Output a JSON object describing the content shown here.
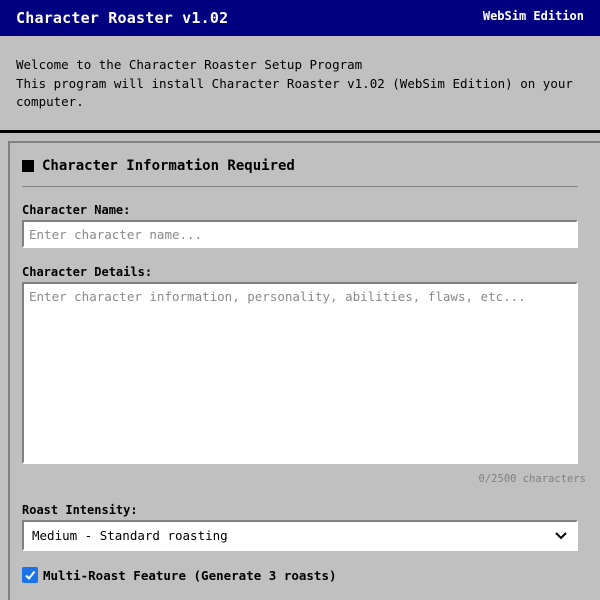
{
  "titlebar": {
    "title": "Character Roaster v1.02",
    "edition": "WebSim Edition"
  },
  "welcome": {
    "line1": "Welcome to the Character Roaster Setup Program",
    "line2": "This program will install Character Roaster v1.02 (WebSim Edition) on your computer."
  },
  "section": {
    "title": "Character Information Required"
  },
  "form": {
    "name_label": "Character Name:",
    "name_placeholder": "Enter character name...",
    "name_value": "",
    "details_label": "Character Details:",
    "details_placeholder": "Enter character information, personality, abilities, flaws, etc...",
    "details_value": "",
    "char_count": "0/2500 characters",
    "intensity_label": "Roast Intensity:",
    "intensity_selected": "Medium - Standard roasting",
    "multi_roast_label": "Multi-Roast Feature (Generate 3 roasts)",
    "multi_roast_checked": true
  },
  "colors": {
    "titlebar_bg": "#000080",
    "window_bg": "#c0c0c0",
    "checkbox_accent": "#1a73e8"
  },
  "icons": {
    "section_marker": "black-square-icon",
    "select_arrow": "chevron-down-icon",
    "checkmark": "checkmark-icon"
  }
}
